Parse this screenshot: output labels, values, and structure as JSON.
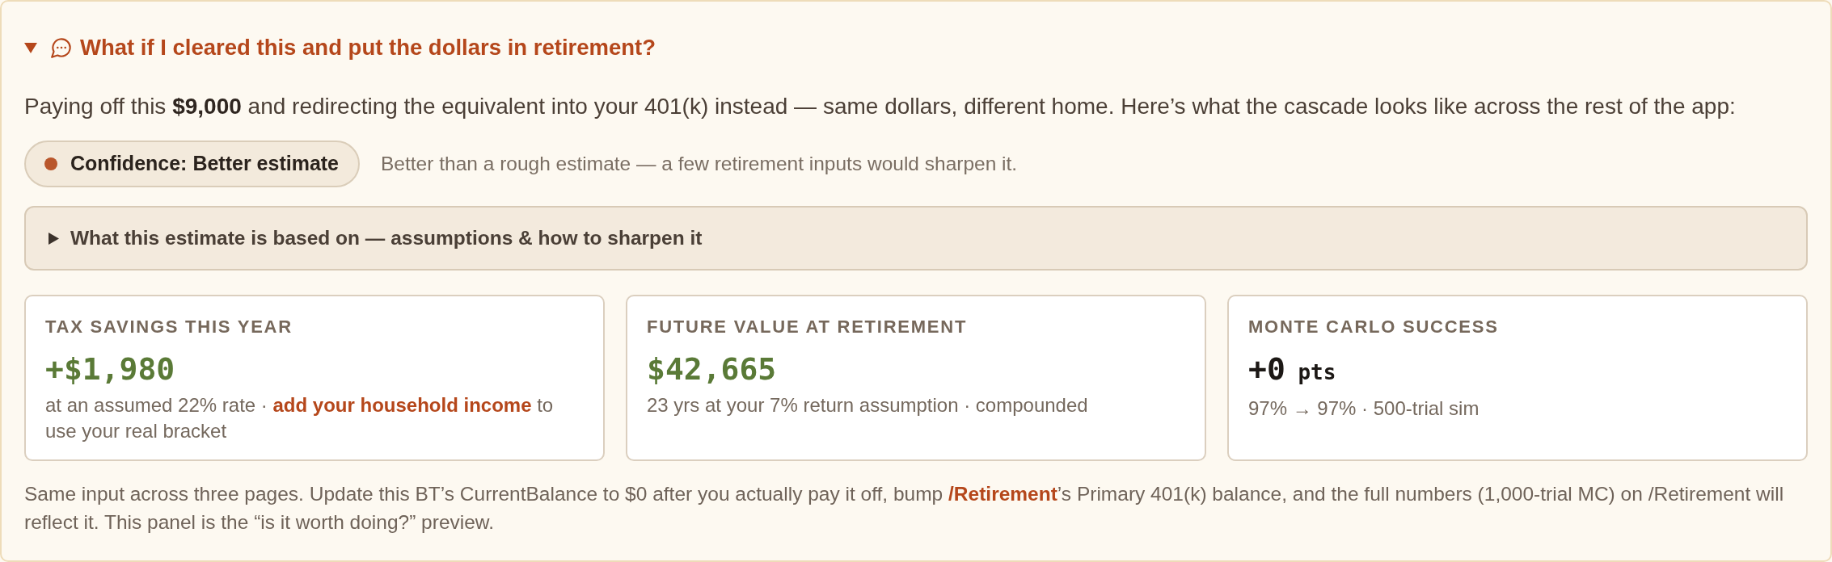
{
  "panel": {
    "title": "What if I cleared this and put the dollars in retirement?",
    "expanded": true
  },
  "intro": "Paying off this **$9,000** and redirecting the equivalent into your 401(k) instead — same dollars, different home. Here’s what the cascade looks like across the rest of the app:",
  "confidence": {
    "label": "Confidence: Better estimate",
    "color": "#b9572c",
    "note": "Better than a rough estimate — a few retirement inputs would sharpen it."
  },
  "assumptions": {
    "title": "What this estimate is based on — assumptions & how to sharpen it",
    "expanded": false
  },
  "cards": [
    {
      "label": "TAX SAVINGS THIS YEAR",
      "value": "+$1,980",
      "color": "#5a7a37",
      "detail": [
        {
          "kind": "plain",
          "text": "at an assumed 22% rate · "
        },
        {
          "kind": "link",
          "text": "add your household income"
        },
        {
          "kind": "plain",
          "text": " to use your real bracket"
        }
      ]
    },
    {
      "label": "FUTURE VALUE AT RETIREMENT",
      "value": "$42,665",
      "color": "#5a7a37",
      "detail": [
        {
          "kind": "plain",
          "text": "23 yrs at your 7% return assumption · compounded"
        }
      ]
    },
    {
      "label": "MONTE CARLO SUCCESS",
      "value": "+0",
      "unit": "pts",
      "color": "#1c1815",
      "detail": [
        {
          "kind": "plain",
          "text": "97% → 97% · 500-trial sim"
        }
      ]
    }
  ],
  "footer": [
    {
      "kind": "plain",
      "text": "Same input across three pages. Update this BT’s CurrentBalance to $0 after you actually pay it off, bump "
    },
    {
      "kind": "link",
      "text": "/Retirement"
    },
    {
      "kind": "plain",
      "text": "’s Primary 401(k) balance, and the full numbers (1,000-trial MC) on /Retirement will reflect it. This panel is the “is it worth doing?” preview."
    }
  ]
}
